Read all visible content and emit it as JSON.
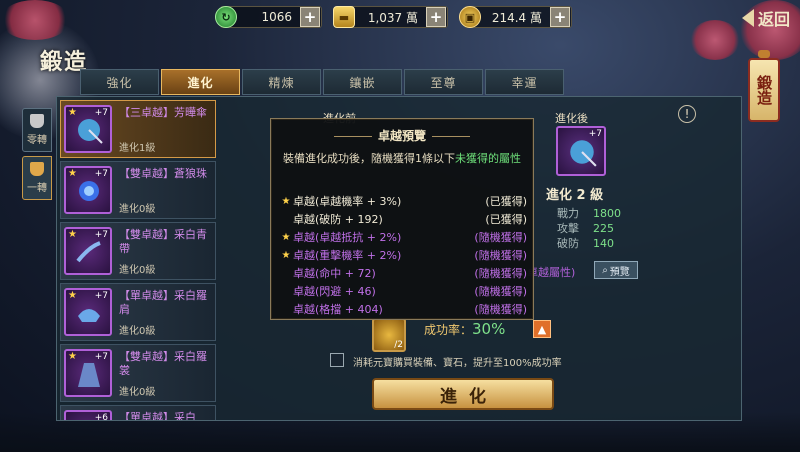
{
  "resources": [
    {
      "icon": "jade-icon",
      "value": "1066"
    },
    {
      "icon": "gold-ingot-icon",
      "value": "1,037 萬"
    },
    {
      "icon": "coin-icon",
      "value": "214.4 萬"
    }
  ],
  "back_label": "返回",
  "page_title": "鍛造",
  "banner_text": "鍛造",
  "tabs": [
    "強化",
    "進化",
    "精煉",
    "鑲嵌",
    "至尊",
    "幸運"
  ],
  "active_tab": "進化",
  "side_tabs": [
    "零轉",
    "一轉"
  ],
  "items": [
    {
      "name": "【三卓越】芳曄傘",
      "level": "進化1級",
      "plus": "+7"
    },
    {
      "name": "【雙卓越】蒼狼珠",
      "level": "進化0級",
      "plus": "+7"
    },
    {
      "name": "【雙卓越】采白青帶",
      "level": "進化0級",
      "plus": "+7"
    },
    {
      "name": "【單卓越】采白羅肩",
      "level": "進化0級",
      "plus": "+7"
    },
    {
      "name": "【雙卓越】采白羅裳",
      "level": "進化0級",
      "plus": "+7"
    },
    {
      "name": "【單卓越】采白",
      "level": "",
      "plus": "+6"
    }
  ],
  "before_label": "進化前",
  "after_label": "進化後",
  "after_plus": "+7",
  "after_level": "進化 2 級",
  "stats": [
    {
      "label": "戰力",
      "value": "1800"
    },
    {
      "label": "攻擊",
      "value": "225"
    },
    {
      "label": "破防",
      "value": "140"
    }
  ],
  "excel_attr_label": "卓越屬性)",
  "preview_button": "預覽",
  "material_count": "/2",
  "success_label": "成功率：",
  "success_value": "30%",
  "checkbox_text": "消耗元寶購買裝備、寶石，提升至100%成功率",
  "advance_button": "進化",
  "popup": {
    "title": "卓越預覽",
    "desc_prefix": "裝備進化成功後，隨機獲得1條以下",
    "desc_green": "未獲得的屬性",
    "rows": [
      {
        "star": true,
        "text": "卓越(卓越機率 + 3%)",
        "status": "(已獲得)",
        "color": "white"
      },
      {
        "star": false,
        "text": "卓越(破防 + 192)",
        "status": "(已獲得)",
        "color": "white"
      },
      {
        "star": true,
        "text": "卓越(卓越抵抗 + 2%)",
        "status": "(隨機獲得)",
        "color": "purple"
      },
      {
        "star": true,
        "text": "卓越(重擊機率 + 2%)",
        "status": "(隨機獲得)",
        "color": "purple"
      },
      {
        "star": false,
        "text": "卓越(命中 + 72)",
        "status": "(隨機獲得)",
        "color": "purple"
      },
      {
        "star": false,
        "text": "卓越(閃避 + 46)",
        "status": "(隨機獲得)",
        "color": "purple"
      },
      {
        "star": false,
        "text": "卓越(格擋 + 404)",
        "status": "(隨機獲得)",
        "color": "purple"
      }
    ]
  }
}
